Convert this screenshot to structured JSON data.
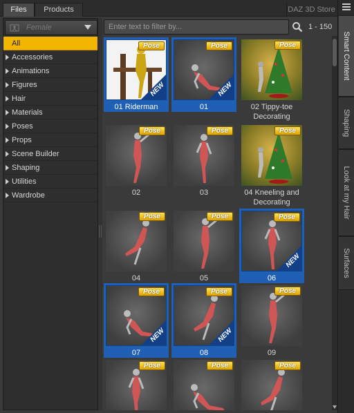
{
  "tabs": [
    {
      "label": "Files",
      "active": true
    },
    {
      "label": "Products",
      "active": false
    }
  ],
  "store_label": "DAZ 3D Store",
  "side_tabs": [
    {
      "label": "Smart Content",
      "active": true
    },
    {
      "label": "Shaping",
      "active": false
    },
    {
      "label": "Look at my Hair",
      "active": false
    },
    {
      "label": "Surfaces",
      "active": false
    }
  ],
  "figure_selector": {
    "value": "Female",
    "icon": "figure-icon"
  },
  "categories": {
    "all": "All",
    "items": [
      "Accessories",
      "Animations",
      "Figures",
      "Hair",
      "Materials",
      "Poses",
      "Props",
      "Scene Builder",
      "Shaping",
      "Utilities",
      "Wardrobe"
    ]
  },
  "filter": {
    "placeholder": "Enter text to filter by...",
    "value": ""
  },
  "range": "1 - 150",
  "badge": "Pose",
  "new_tag": "NEW",
  "items": [
    {
      "label": "01 Riderman",
      "selected": true,
      "new": true,
      "style": "white"
    },
    {
      "label": "01",
      "selected": true,
      "new": true,
      "style": "pose"
    },
    {
      "label": "02 Tippy-toe Decorating",
      "selected": false,
      "new": false,
      "style": "tree"
    },
    {
      "label": "02",
      "selected": false,
      "new": false,
      "style": "pose"
    },
    {
      "label": "03",
      "selected": false,
      "new": false,
      "style": "pose"
    },
    {
      "label": "04 Kneeling and Decorating",
      "selected": false,
      "new": false,
      "style": "tree"
    },
    {
      "label": "04",
      "selected": false,
      "new": false,
      "style": "pose"
    },
    {
      "label": "05",
      "selected": false,
      "new": false,
      "style": "pose"
    },
    {
      "label": "06",
      "selected": true,
      "new": true,
      "style": "pose"
    },
    {
      "label": "07",
      "selected": true,
      "new": true,
      "style": "pose"
    },
    {
      "label": "08",
      "selected": true,
      "new": true,
      "style": "pose"
    },
    {
      "label": "09",
      "selected": false,
      "new": false,
      "style": "pose"
    },
    {
      "label": "",
      "selected": false,
      "new": false,
      "style": "pose"
    },
    {
      "label": "",
      "selected": false,
      "new": false,
      "style": "pose"
    },
    {
      "label": "",
      "selected": false,
      "new": false,
      "style": "pose"
    }
  ],
  "colors": {
    "accent": "#f2b600",
    "selection": "#1f5fb4",
    "background": "#3a3a3a"
  }
}
